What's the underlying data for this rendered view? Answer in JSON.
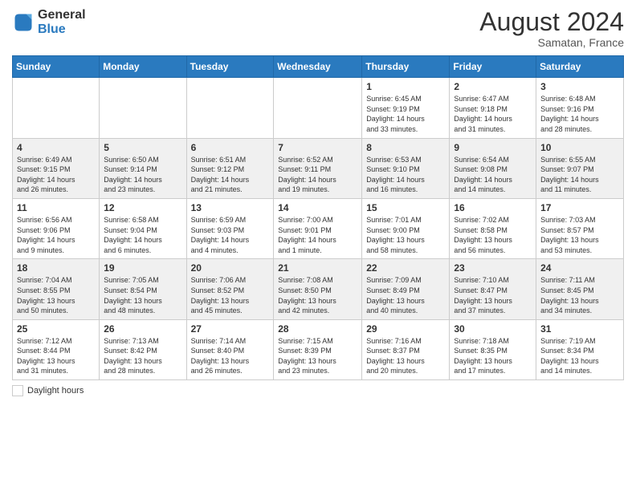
{
  "header": {
    "logo_general": "General",
    "logo_blue": "Blue",
    "month": "August 2024",
    "location": "Samatan, France"
  },
  "weekdays": [
    "Sunday",
    "Monday",
    "Tuesday",
    "Wednesday",
    "Thursday",
    "Friday",
    "Saturday"
  ],
  "weeks": [
    [
      {
        "day": "",
        "info": ""
      },
      {
        "day": "",
        "info": ""
      },
      {
        "day": "",
        "info": ""
      },
      {
        "day": "",
        "info": ""
      },
      {
        "day": "1",
        "info": "Sunrise: 6:45 AM\nSunset: 9:19 PM\nDaylight: 14 hours\nand 33 minutes."
      },
      {
        "day": "2",
        "info": "Sunrise: 6:47 AM\nSunset: 9:18 PM\nDaylight: 14 hours\nand 31 minutes."
      },
      {
        "day": "3",
        "info": "Sunrise: 6:48 AM\nSunset: 9:16 PM\nDaylight: 14 hours\nand 28 minutes."
      }
    ],
    [
      {
        "day": "4",
        "info": "Sunrise: 6:49 AM\nSunset: 9:15 PM\nDaylight: 14 hours\nand 26 minutes."
      },
      {
        "day": "5",
        "info": "Sunrise: 6:50 AM\nSunset: 9:14 PM\nDaylight: 14 hours\nand 23 minutes."
      },
      {
        "day": "6",
        "info": "Sunrise: 6:51 AM\nSunset: 9:12 PM\nDaylight: 14 hours\nand 21 minutes."
      },
      {
        "day": "7",
        "info": "Sunrise: 6:52 AM\nSunset: 9:11 PM\nDaylight: 14 hours\nand 19 minutes."
      },
      {
        "day": "8",
        "info": "Sunrise: 6:53 AM\nSunset: 9:10 PM\nDaylight: 14 hours\nand 16 minutes."
      },
      {
        "day": "9",
        "info": "Sunrise: 6:54 AM\nSunset: 9:08 PM\nDaylight: 14 hours\nand 14 minutes."
      },
      {
        "day": "10",
        "info": "Sunrise: 6:55 AM\nSunset: 9:07 PM\nDaylight: 14 hours\nand 11 minutes."
      }
    ],
    [
      {
        "day": "11",
        "info": "Sunrise: 6:56 AM\nSunset: 9:06 PM\nDaylight: 14 hours\nand 9 minutes."
      },
      {
        "day": "12",
        "info": "Sunrise: 6:58 AM\nSunset: 9:04 PM\nDaylight: 14 hours\nand 6 minutes."
      },
      {
        "day": "13",
        "info": "Sunrise: 6:59 AM\nSunset: 9:03 PM\nDaylight: 14 hours\nand 4 minutes."
      },
      {
        "day": "14",
        "info": "Sunrise: 7:00 AM\nSunset: 9:01 PM\nDaylight: 14 hours\nand 1 minute."
      },
      {
        "day": "15",
        "info": "Sunrise: 7:01 AM\nSunset: 9:00 PM\nDaylight: 13 hours\nand 58 minutes."
      },
      {
        "day": "16",
        "info": "Sunrise: 7:02 AM\nSunset: 8:58 PM\nDaylight: 13 hours\nand 56 minutes."
      },
      {
        "day": "17",
        "info": "Sunrise: 7:03 AM\nSunset: 8:57 PM\nDaylight: 13 hours\nand 53 minutes."
      }
    ],
    [
      {
        "day": "18",
        "info": "Sunrise: 7:04 AM\nSunset: 8:55 PM\nDaylight: 13 hours\nand 50 minutes."
      },
      {
        "day": "19",
        "info": "Sunrise: 7:05 AM\nSunset: 8:54 PM\nDaylight: 13 hours\nand 48 minutes."
      },
      {
        "day": "20",
        "info": "Sunrise: 7:06 AM\nSunset: 8:52 PM\nDaylight: 13 hours\nand 45 minutes."
      },
      {
        "day": "21",
        "info": "Sunrise: 7:08 AM\nSunset: 8:50 PM\nDaylight: 13 hours\nand 42 minutes."
      },
      {
        "day": "22",
        "info": "Sunrise: 7:09 AM\nSunset: 8:49 PM\nDaylight: 13 hours\nand 40 minutes."
      },
      {
        "day": "23",
        "info": "Sunrise: 7:10 AM\nSunset: 8:47 PM\nDaylight: 13 hours\nand 37 minutes."
      },
      {
        "day": "24",
        "info": "Sunrise: 7:11 AM\nSunset: 8:45 PM\nDaylight: 13 hours\nand 34 minutes."
      }
    ],
    [
      {
        "day": "25",
        "info": "Sunrise: 7:12 AM\nSunset: 8:44 PM\nDaylight: 13 hours\nand 31 minutes."
      },
      {
        "day": "26",
        "info": "Sunrise: 7:13 AM\nSunset: 8:42 PM\nDaylight: 13 hours\nand 28 minutes."
      },
      {
        "day": "27",
        "info": "Sunrise: 7:14 AM\nSunset: 8:40 PM\nDaylight: 13 hours\nand 26 minutes."
      },
      {
        "day": "28",
        "info": "Sunrise: 7:15 AM\nSunset: 8:39 PM\nDaylight: 13 hours\nand 23 minutes."
      },
      {
        "day": "29",
        "info": "Sunrise: 7:16 AM\nSunset: 8:37 PM\nDaylight: 13 hours\nand 20 minutes."
      },
      {
        "day": "30",
        "info": "Sunrise: 7:18 AM\nSunset: 8:35 PM\nDaylight: 13 hours\nand 17 minutes."
      },
      {
        "day": "31",
        "info": "Sunrise: 7:19 AM\nSunset: 8:34 PM\nDaylight: 13 hours\nand 14 minutes."
      }
    ]
  ],
  "footer": {
    "legend_label": "Daylight hours"
  }
}
